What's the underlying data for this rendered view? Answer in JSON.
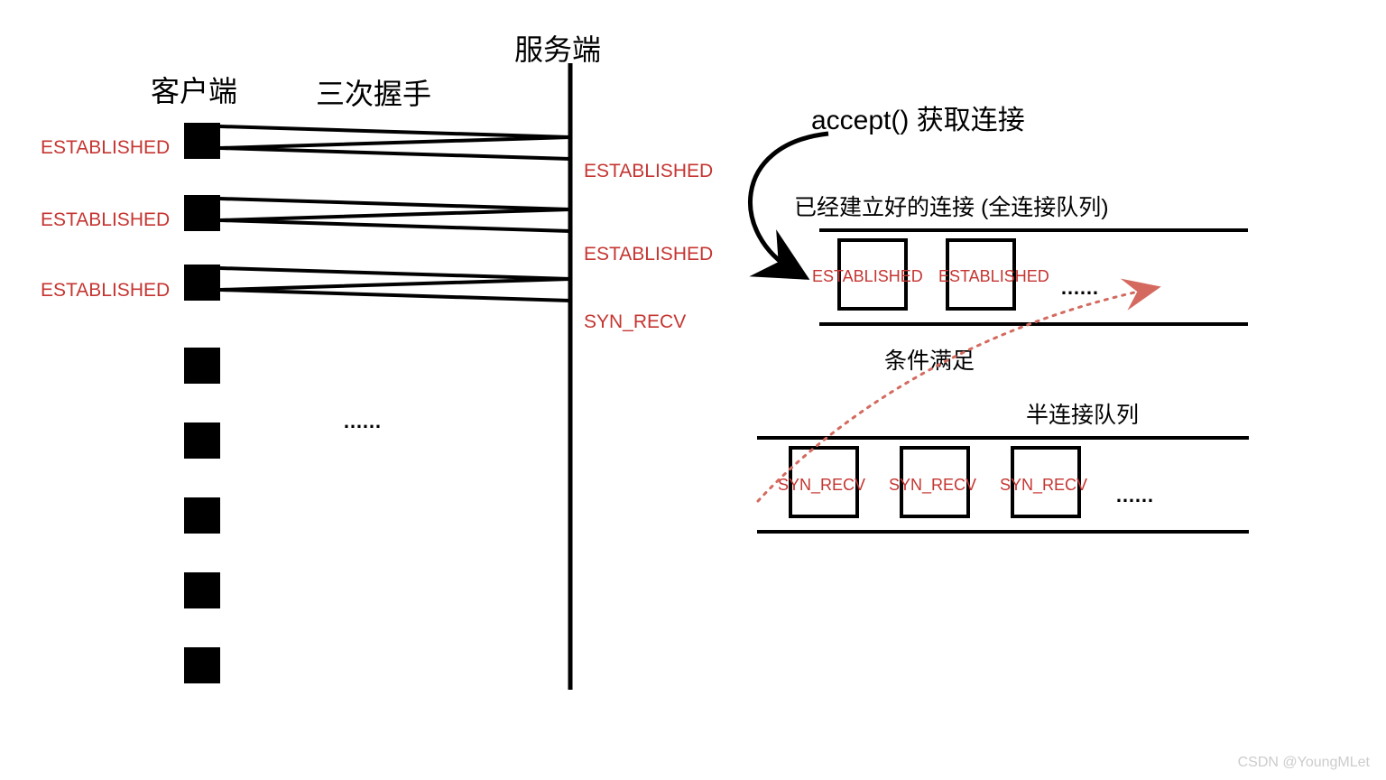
{
  "labels": {
    "client": "客户端",
    "server": "服务端",
    "handshake": "三次握手",
    "accept": "accept() 获取连接",
    "established_queue": "已经建立好的连接 (全连接队列)",
    "syn_queue": "半连接队列",
    "condition": "条件满足",
    "ellipsis": "……",
    "watermark": "CSDN @YoungMLet"
  },
  "states": {
    "established": "ESTABLISHED",
    "syn_recv": "SYN_RECV"
  },
  "client_states": [
    "ESTABLISHED",
    "ESTABLISHED",
    "ESTABLISHED"
  ],
  "server_states": [
    "ESTABLISHED",
    "ESTABLISHED",
    "SYN_RECV"
  ],
  "full_queue_items": [
    "ESTABLISHED",
    "ESTABLISHED"
  ],
  "half_queue_items": [
    "SYN_RECV",
    "SYN_RECV",
    "SYN_RECV"
  ]
}
